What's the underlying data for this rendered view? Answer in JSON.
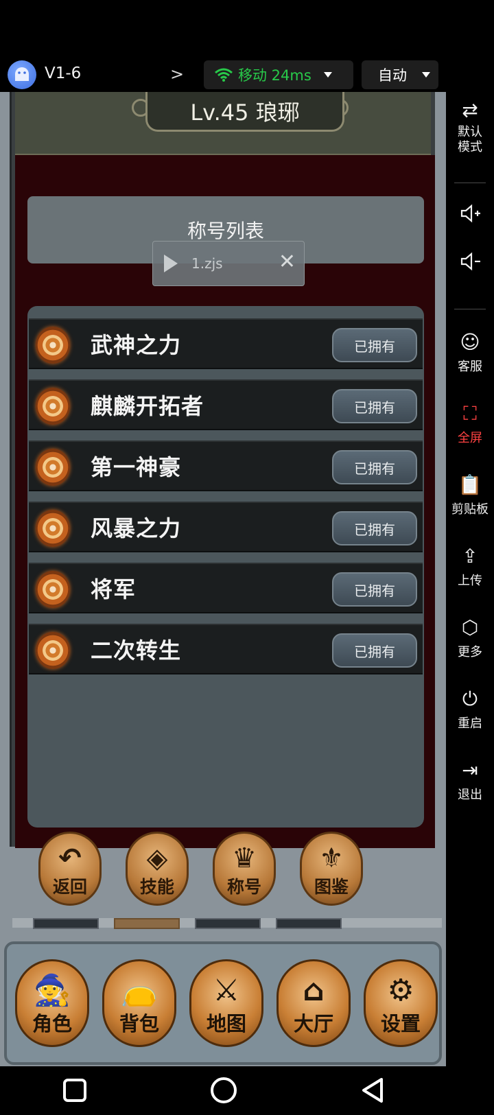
{
  "topbar": {
    "app_name": "V1-6",
    "network": "移动 24ms",
    "quality": "自动",
    "accent_green": "#28c94a"
  },
  "game": {
    "level_title": "Lv.45 琅琊",
    "panel_title": "称号列表",
    "script_chip": {
      "name": "1.zjs"
    },
    "titles": [
      {
        "name": "武神之力",
        "status": "已拥有"
      },
      {
        "name": "麒麟开拓者",
        "status": "已拥有"
      },
      {
        "name": "第一神豪",
        "status": "已拥有"
      },
      {
        "name": "风暴之力",
        "status": "已拥有"
      },
      {
        "name": "将军",
        "status": "已拥有"
      },
      {
        "name": "二次转生",
        "status": "已拥有"
      }
    ],
    "sub_buttons": [
      {
        "label": "返回",
        "icon": "undo-icon"
      },
      {
        "label": "技能",
        "icon": "skill-icon"
      },
      {
        "label": "称号",
        "icon": "crown-icon"
      },
      {
        "label": "图鉴",
        "icon": "dragon-icon"
      }
    ],
    "main_buttons": [
      {
        "label": "角色",
        "icon": "wizard-icon"
      },
      {
        "label": "背包",
        "icon": "bag-icon"
      },
      {
        "label": "地图",
        "icon": "swords-icon"
      },
      {
        "label": "大厅",
        "icon": "house-icon"
      },
      {
        "label": "设置",
        "icon": "gears-icon"
      }
    ]
  },
  "side_panel": {
    "items": [
      {
        "label": "默认\n模式",
        "icon": "swap-icon"
      },
      {
        "label": "",
        "icon": "volume-up-icon"
      },
      {
        "label": "",
        "icon": "volume-down-icon"
      },
      {
        "label": "客服",
        "icon": "support-icon"
      },
      {
        "label": "全屏",
        "icon": "fullscreen-icon",
        "active": true
      },
      {
        "label": "剪贴板",
        "icon": "clipboard-icon"
      },
      {
        "label": "上传",
        "icon": "upload-icon"
      },
      {
        "label": "更多",
        "icon": "more-icon"
      },
      {
        "label": "重启",
        "icon": "power-icon"
      },
      {
        "label": "退出",
        "icon": "exit-icon"
      }
    ],
    "active_color": "#ff4242"
  }
}
